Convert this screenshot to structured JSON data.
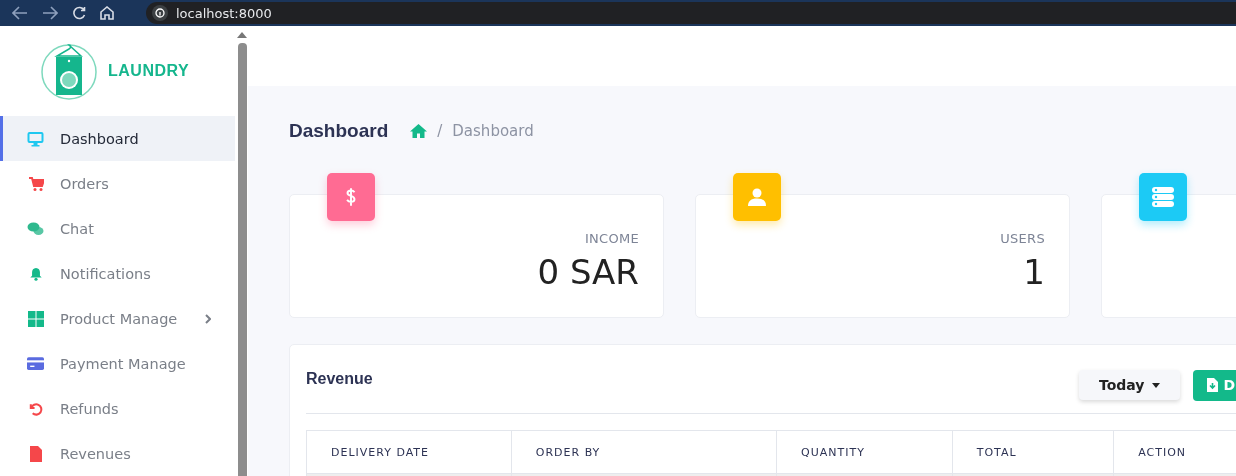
{
  "browser": {
    "url": "localhost:8000"
  },
  "sidebar": {
    "brand": "LAUNDRY",
    "items": [
      {
        "label": "Dashboard",
        "color": "#1fc8f0",
        "selected": true,
        "expandable": false
      },
      {
        "label": "Orders",
        "color": "#f5474a",
        "selected": false,
        "expandable": false
      },
      {
        "label": "Chat",
        "color": "#2fb98e",
        "selected": false,
        "expandable": false
      },
      {
        "label": "Notifications",
        "color": "#13b98a",
        "selected": false,
        "expandable": false
      },
      {
        "label": "Product Manage",
        "color": "#13b98a",
        "selected": false,
        "expandable": true
      },
      {
        "label": "Payment Manage",
        "color": "#5a6be0",
        "selected": false,
        "expandable": false
      },
      {
        "label": "Refunds",
        "color": "#f5474a",
        "selected": false,
        "expandable": false
      },
      {
        "label": "Revenues",
        "color": "#f5474a",
        "selected": false,
        "expandable": false
      }
    ]
  },
  "page": {
    "title": "Dashboard",
    "breadcrumb": [
      {
        "separator": "/",
        "label": "Dashboard"
      }
    ]
  },
  "stats": [
    {
      "color": "#ff6b93",
      "label": "INCOME",
      "value": "0 SAR"
    },
    {
      "color": "#ffbf00",
      "label": "USERS",
      "value": "1"
    },
    {
      "color": "#1ccaf5"
    }
  ],
  "revenue": {
    "title": "Revenue",
    "period": "Today",
    "export_label": "D",
    "table": {
      "columns": [
        "DELIVERY DATE",
        "ORDER BY",
        "QUANTITY",
        "TOTAL",
        "ACTION"
      ]
    }
  }
}
